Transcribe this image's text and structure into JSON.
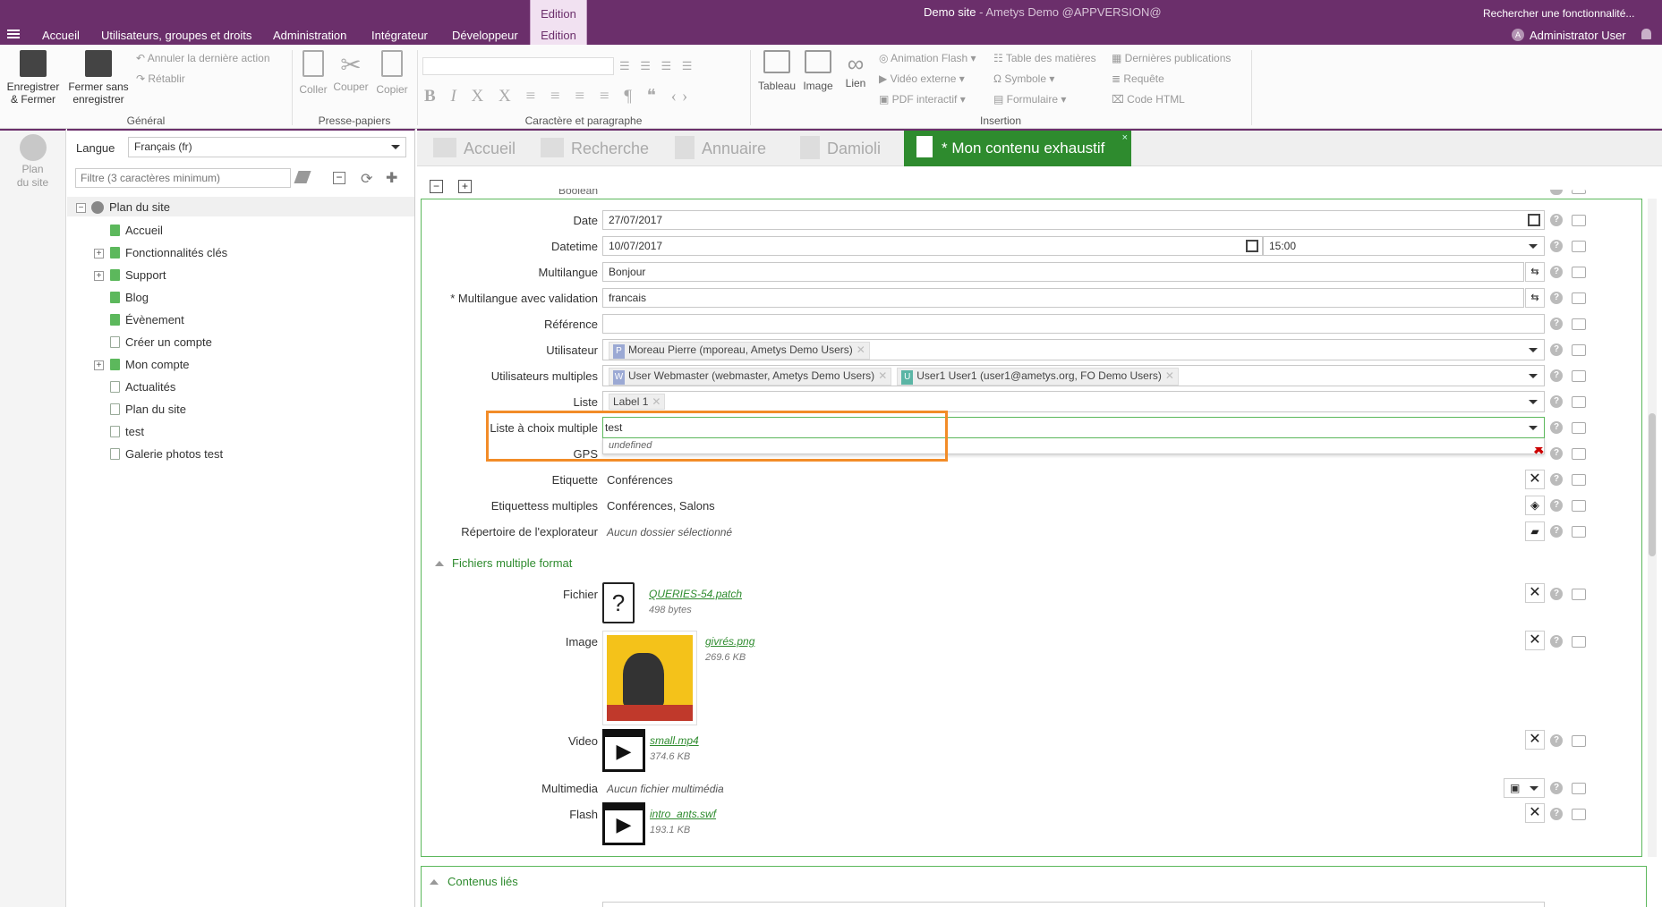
{
  "window": {
    "site": "Demo site",
    "separator": " - ",
    "app": "Ametys Demo @APPVERSION@",
    "search": "Rechercher une fonctionnalité...",
    "user": "Administrator User",
    "user_initial": "A"
  },
  "menu": {
    "tabs": [
      "Accueil",
      "Utilisateurs, groupes et droits",
      "Administration",
      "Intégrateur",
      "Développeur"
    ],
    "context_group": "Edition",
    "context_tab": "Edition"
  },
  "ribbon": {
    "save_close": "Enregistrer\n& Fermer",
    "close_nosave": "Fermer sans\nenregistrer",
    "undo": "Annuler la dernière action",
    "redo": "Rétablir",
    "group_general": "Général",
    "paste": "Coller",
    "cut": "Couper",
    "copy": "Copier",
    "group_clipboard": "Presse-papiers",
    "group_char": "Caractère et paragraphe",
    "table": "Tableau",
    "image": "Image",
    "link": "Lien",
    "flash": "Animation Flash",
    "video": "Vidéo externe",
    "pdf": "PDF interactif",
    "toc": "Table des matières",
    "symbol": "Symbole",
    "form": "Formulaire",
    "latest": "Dernières publications",
    "query": "Requête",
    "html": "Code HTML",
    "group_insert": "Insertion"
  },
  "leftstrip": {
    "label": "Plan\ndu site"
  },
  "tree": {
    "lang_label": "Langue",
    "lang_value": "Français (fr)",
    "filter_placeholder": "Filtre (3 caractères minimum)",
    "root": "Plan du site",
    "items": [
      {
        "label": "Accueil",
        "expand": false,
        "green": true
      },
      {
        "label": "Fonctionnalités clés",
        "expand": true,
        "green": true
      },
      {
        "label": "Support",
        "expand": true,
        "green": true
      },
      {
        "label": "Blog",
        "expand": false,
        "green": true
      },
      {
        "label": "Évènement",
        "expand": false,
        "green": true
      },
      {
        "label": "Créer un compte",
        "expand": false,
        "green": false
      },
      {
        "label": "Mon compte",
        "expand": true,
        "green": true
      },
      {
        "label": "Actualités",
        "expand": false,
        "green": false
      },
      {
        "label": "Plan du site",
        "expand": false,
        "green": false
      },
      {
        "label": "test",
        "expand": false,
        "green": false
      },
      {
        "label": "Galerie photos test",
        "expand": false,
        "green": false
      }
    ]
  },
  "doctabs": {
    "home": "Accueil",
    "search": "Recherche",
    "directory": "Annuaire",
    "damioli": "Damioli",
    "active": "* Mon contenu exhaustif"
  },
  "form": {
    "boolean": "Boolean",
    "date_label": "Date",
    "date_value": "27/07/2017",
    "datetime_label": "Datetime",
    "datetime_date": "10/07/2017",
    "datetime_time": "15:00",
    "multilang_label": "Multilangue",
    "multilang_value": "Bonjour",
    "multilang_valid_label": "* Multilangue avec validation",
    "multilang_valid_value": "francais",
    "reference_label": "Référence",
    "reference_value": "",
    "user_label": "Utilisateur",
    "user_initial": "P",
    "user_value": "Moreau Pierre (mporeau, Ametys Demo Users)",
    "users_label": "Utilisateurs multiples",
    "users": [
      {
        "initial": "W",
        "name": "User Webmaster (webmaster, Ametys Demo Users)"
      },
      {
        "initial": "U",
        "name": "User1 User1 (user1@ametys.org, FO Demo Users)"
      }
    ],
    "list_label": "Liste",
    "list_value": "Label 1",
    "multi_label": "Liste à choix multiple",
    "multi_value": "test",
    "multi_option": "undefined",
    "gps_label": "GPS",
    "tag_label": "Etiquette",
    "tag_value": "Conférences",
    "tags_label": "Etiquettess multiples",
    "tags_value": "Conférences, Salons",
    "explorer_label": "Répertoire de l'explorateur",
    "explorer_value": "Aucun dossier sélectionné",
    "section_files": "Fichiers multiple format",
    "file_label": "Fichier",
    "file_name": "QUERIES-54.patch",
    "file_size": "498 bytes",
    "image_label": "Image",
    "image_name": "givrés.png",
    "image_size": "269.6 KB",
    "video_label": "Video",
    "video_name": "small.mp4",
    "video_size": "374.6 KB",
    "multimedia_label": "Multimedia",
    "multimedia_value": "Aucun fichier multimédia",
    "flash_label": "Flash",
    "flash_name": "intro_ants.swf",
    "flash_size": "193.1 KB",
    "section_related": "Contenus liés"
  },
  "colors": {
    "brand": "#6b2f6b",
    "highlight": "#f28c28",
    "accent": "#2e8b2e"
  }
}
